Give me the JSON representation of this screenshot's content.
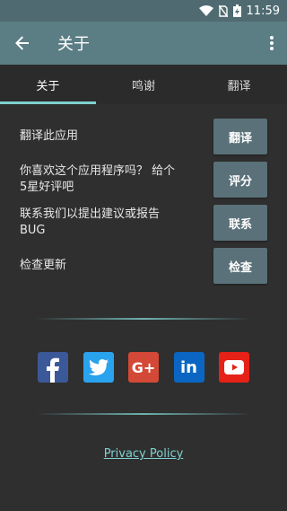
{
  "status_bar": {
    "time": "11:59"
  },
  "app_bar": {
    "title": "关于"
  },
  "tabs": [
    {
      "label": "关于",
      "active": true
    },
    {
      "label": "鸣谢",
      "active": false
    },
    {
      "label": "翻译",
      "active": false
    }
  ],
  "rows": [
    {
      "label": "翻译此应用",
      "button": "翻译"
    },
    {
      "label": "你喜欢这个应用程序吗？ 给个5星好评吧",
      "button": "评分"
    },
    {
      "label": "联系我们以提出建议或报告BUG",
      "button": "联系"
    },
    {
      "label": "检查更新",
      "button": "检查"
    }
  ],
  "social": [
    "facebook-icon",
    "twitter-icon",
    "google-plus-icon",
    "linkedin-icon",
    "youtube-icon"
  ],
  "privacy_policy": "Privacy Policy",
  "colors": {
    "accent": "#7fd1d0",
    "app_bar": "#5b7d84",
    "status_bar": "#4f6b71",
    "button": "#5a7179"
  }
}
